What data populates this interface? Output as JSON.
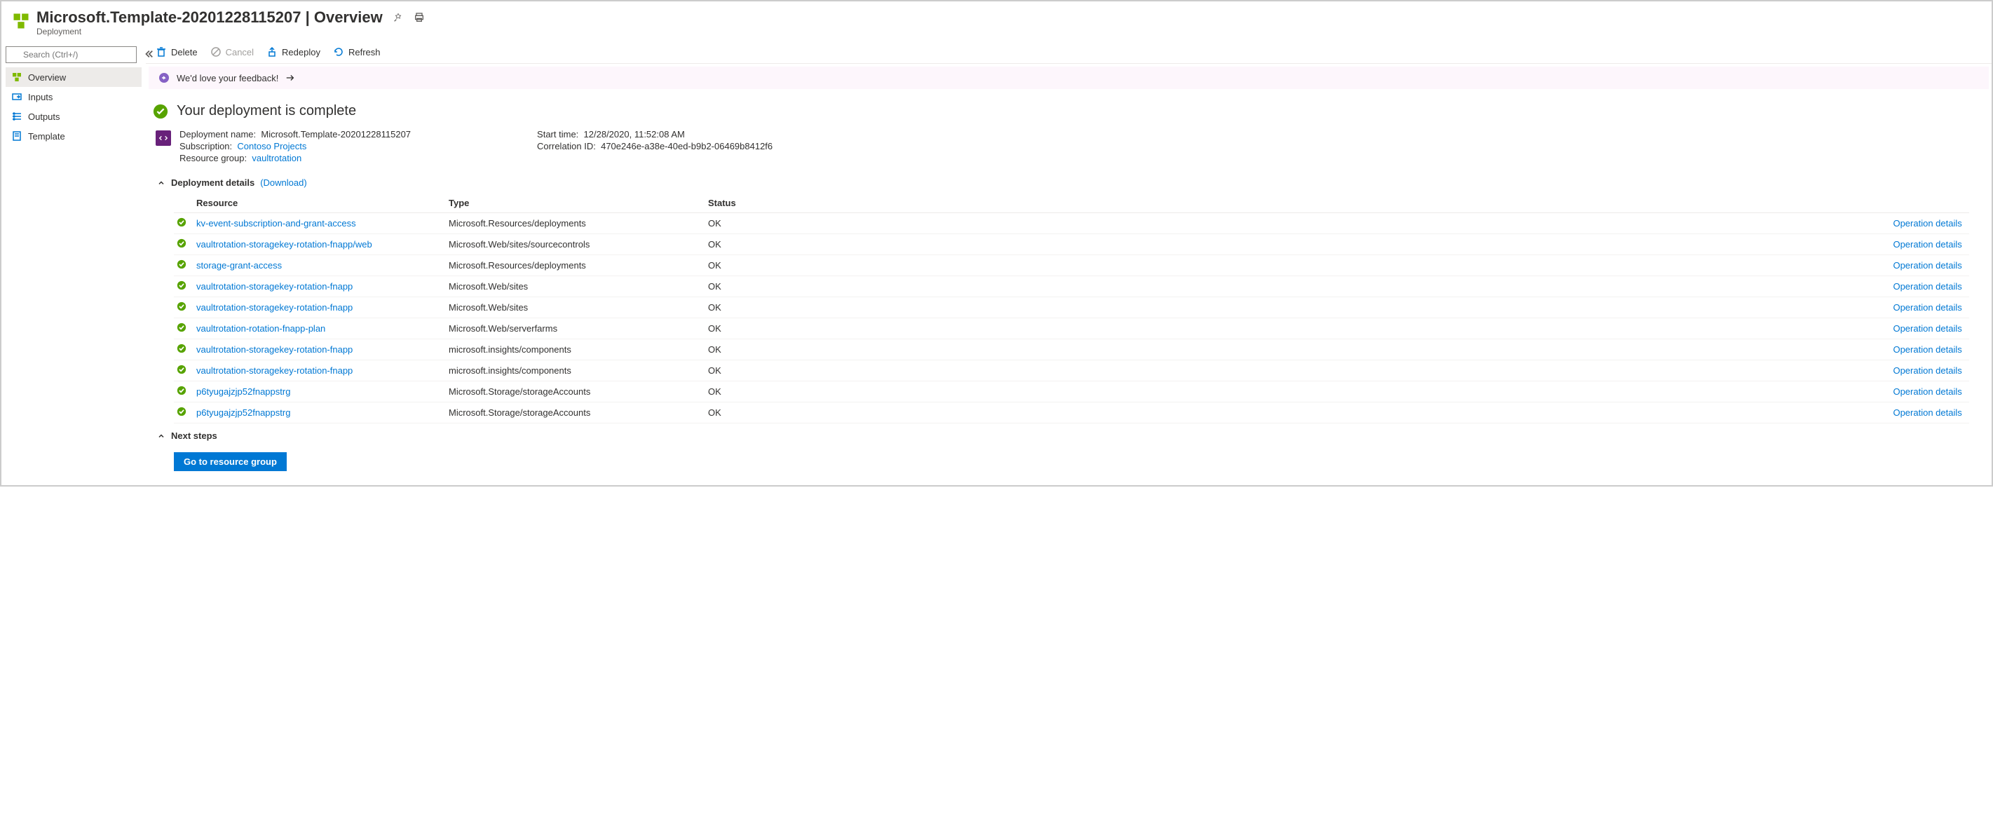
{
  "header": {
    "title": "Microsoft.Template-20201228115207 | Overview",
    "subtitle": "Deployment"
  },
  "sidebar": {
    "search_placeholder": "Search (Ctrl+/)",
    "items": [
      {
        "label": "Overview"
      },
      {
        "label": "Inputs"
      },
      {
        "label": "Outputs"
      },
      {
        "label": "Template"
      }
    ]
  },
  "toolbar": {
    "delete": "Delete",
    "cancel": "Cancel",
    "redeploy": "Redeploy",
    "refresh": "Refresh"
  },
  "feedback": {
    "text": "We'd love your feedback!"
  },
  "status": {
    "title": "Your deployment is complete"
  },
  "meta": {
    "deployment_name_label": "Deployment name:",
    "deployment_name": "Microsoft.Template-20201228115207",
    "subscription_label": "Subscription:",
    "subscription": "Contoso Projects",
    "resource_group_label": "Resource group:",
    "resource_group": "vaultrotation",
    "start_time_label": "Start time:",
    "start_time": "12/28/2020, 11:52:08 AM",
    "correlation_id_label": "Correlation ID:",
    "correlation_id": "470e246e-a38e-40ed-b9b2-06469b8412f6"
  },
  "sections": {
    "deployment_details": "Deployment details",
    "download": "(Download)",
    "next_steps": "Next steps"
  },
  "table": {
    "headers": {
      "resource": "Resource",
      "type": "Type",
      "status": "Status",
      "op": "Operation details"
    },
    "op_link": "Operation details",
    "rows": [
      {
        "resource": "kv-event-subscription-and-grant-access",
        "type": "Microsoft.Resources/deployments",
        "status": "OK"
      },
      {
        "resource": "vaultrotation-storagekey-rotation-fnapp/web",
        "type": "Microsoft.Web/sites/sourcecontrols",
        "status": "OK"
      },
      {
        "resource": "storage-grant-access",
        "type": "Microsoft.Resources/deployments",
        "status": "OK"
      },
      {
        "resource": "vaultrotation-storagekey-rotation-fnapp",
        "type": "Microsoft.Web/sites",
        "status": "OK"
      },
      {
        "resource": "vaultrotation-storagekey-rotation-fnapp",
        "type": "Microsoft.Web/sites",
        "status": "OK"
      },
      {
        "resource": "vaultrotation-rotation-fnapp-plan",
        "type": "Microsoft.Web/serverfarms",
        "status": "OK"
      },
      {
        "resource": "vaultrotation-storagekey-rotation-fnapp",
        "type": "microsoft.insights/components",
        "status": "OK"
      },
      {
        "resource": "vaultrotation-storagekey-rotation-fnapp",
        "type": "microsoft.insights/components",
        "status": "OK"
      },
      {
        "resource": "p6tyugajzjp52fnappstrg",
        "type": "Microsoft.Storage/storageAccounts",
        "status": "OK"
      },
      {
        "resource": "p6tyugajzjp52fnappstrg",
        "type": "Microsoft.Storage/storageAccounts",
        "status": "OK"
      }
    ]
  },
  "buttons": {
    "go_to_rg": "Go to resource group"
  }
}
